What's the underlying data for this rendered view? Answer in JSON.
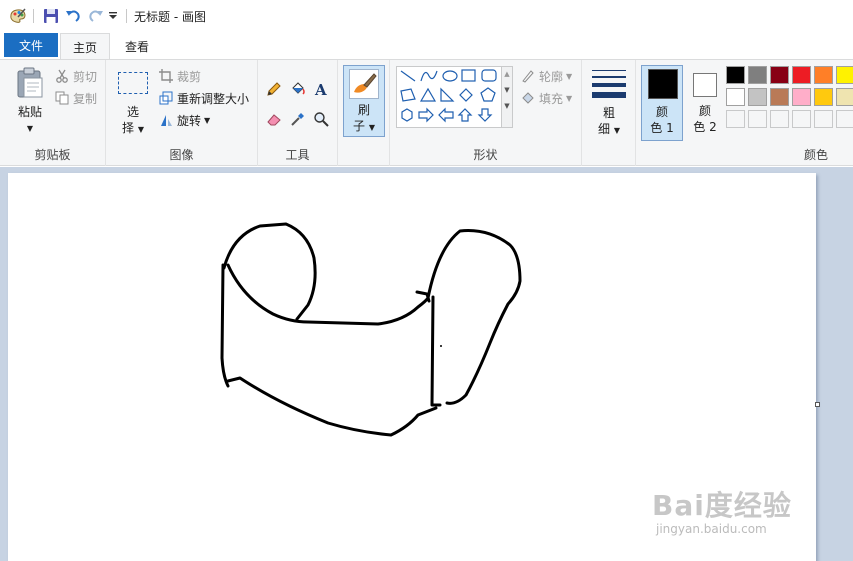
{
  "window": {
    "title": "无标题 - 画图"
  },
  "tabs": {
    "file": "文件",
    "home": "主页",
    "view": "查看"
  },
  "clipboard": {
    "paste": "粘贴",
    "cut": "剪切",
    "copy": "复制",
    "label": "剪贴板"
  },
  "image": {
    "select_line1": "选",
    "select_line2": "择",
    "crop": "裁剪",
    "resize": "重新调整大小",
    "rotate": "旋转",
    "label": "图像"
  },
  "tools": {
    "label": "工具"
  },
  "brushes": {
    "line1": "刷",
    "line2": "子"
  },
  "shapes": {
    "outline": "轮廓",
    "fill": "填充",
    "label": "形状"
  },
  "size": {
    "line1": "粗",
    "line2": "细"
  },
  "colors": {
    "color1_line1": "颜",
    "color1_line2": "色 1",
    "color2_line1": "颜",
    "color2_line2": "色 2",
    "label": "颜色",
    "color1": "#000000",
    "color2": "#ffffff",
    "palette_row1": [
      "#000000",
      "#7f7f7f",
      "#880015",
      "#ed1c24",
      "#ff7f27",
      "#fff200"
    ],
    "palette_row2": [
      "#ffffff",
      "#c3c3c3",
      "#b97a57",
      "#ffaec9",
      "#ffc90e",
      "#efe4b0"
    ]
  },
  "watermark": {
    "main": "Bai度经验",
    "sub": "jingyan.baidu.com"
  }
}
